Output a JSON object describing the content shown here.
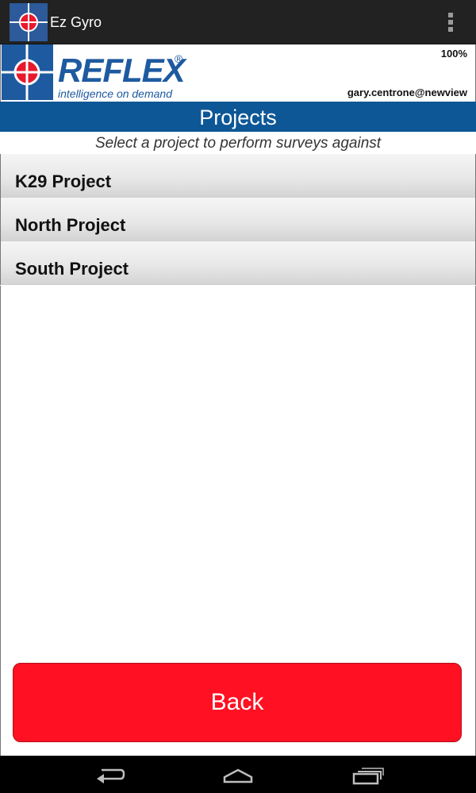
{
  "action_bar": {
    "app_title": "Ez Gyro",
    "app_icon": "gyro-target-icon",
    "overflow_icon": "vertical-dots-icon"
  },
  "header": {
    "logo_text": "REFLEX",
    "logo_registered": "®",
    "logo_tagline": "intelligence on demand",
    "battery": "100%",
    "user_email": "gary.centrone@newview"
  },
  "page": {
    "title": "Projects",
    "subtitle": "Select a project to perform surveys against"
  },
  "projects": [
    {
      "label": "K29 Project"
    },
    {
      "label": "North Project"
    },
    {
      "label": "South Project"
    }
  ],
  "footer": {
    "back_label": "Back"
  },
  "nav_bar": {
    "back_icon": "back-arrow-icon",
    "home_icon": "home-icon",
    "recents_icon": "recent-apps-icon"
  },
  "colors": {
    "brand_blue": "#0d5796",
    "back_red": "#ff1022",
    "action_bar": "#222222"
  }
}
